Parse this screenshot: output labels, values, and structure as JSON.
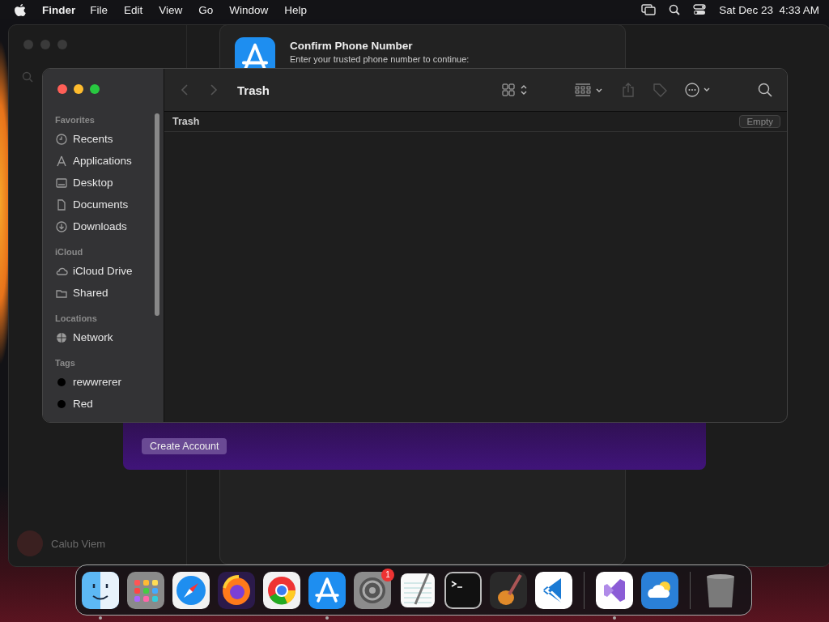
{
  "menu_bar": {
    "app": "Finder",
    "menus": [
      "File",
      "Edit",
      "View",
      "Go",
      "Window",
      "Help"
    ],
    "clock": "Sat Dec 23  4:33 AM"
  },
  "back_window": {
    "user_name": "Calub Viem"
  },
  "dialog": {
    "title": "Confirm Phone Number",
    "subtitle": "Enter your trusted phone number to continue:",
    "button": "Create Account"
  },
  "finder": {
    "title": "Trash",
    "path": "Trash",
    "empty_button": "Empty",
    "sidebar": [
      {
        "heading": "Favorites",
        "items": [
          {
            "label": "Recents",
            "kind": "clock"
          },
          {
            "label": "Applications",
            "kind": "apps"
          },
          {
            "label": "Desktop",
            "kind": "desktop"
          },
          {
            "label": "Documents",
            "kind": "doc"
          },
          {
            "label": "Downloads",
            "kind": "download"
          }
        ]
      },
      {
        "heading": "iCloud",
        "items": [
          {
            "label": "iCloud Drive",
            "kind": "cloud"
          },
          {
            "label": "Shared",
            "kind": "shared"
          }
        ]
      },
      {
        "heading": "Locations",
        "items": [
          {
            "label": "Network",
            "kind": "globe"
          }
        ]
      },
      {
        "heading": "Tags",
        "items": [
          {
            "label": "rewwrerer",
            "kind": "tag"
          },
          {
            "label": "Red",
            "kind": "tag"
          }
        ]
      }
    ]
  },
  "dock": [
    {
      "kind": "app",
      "running": true
    },
    {
      "kind": "app",
      "running": false
    },
    {
      "kind": "app",
      "running": false
    },
    {
      "kind": "app",
      "running": false
    },
    {
      "kind": "app",
      "running": false
    },
    {
      "kind": "app",
      "running": true
    },
    {
      "kind": "app",
      "running": false,
      "badge": "1"
    },
    {
      "kind": "app",
      "running": false
    },
    {
      "kind": "app",
      "running": false
    },
    {
      "kind": "app",
      "running": false
    },
    {
      "kind": "app",
      "running": false
    },
    {
      "kind": "divider"
    },
    {
      "kind": "app",
      "running": true
    },
    {
      "kind": "app",
      "running": false
    },
    {
      "kind": "divider"
    },
    {
      "kind": "app",
      "running": false
    }
  ]
}
